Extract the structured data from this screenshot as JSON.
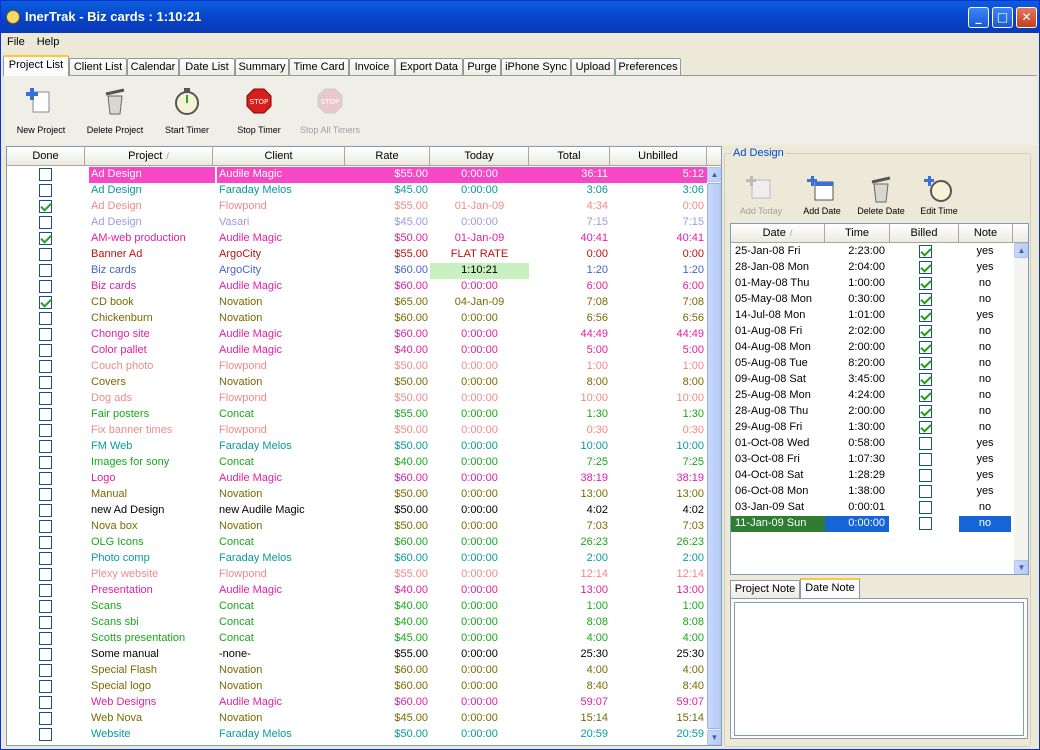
{
  "window": {
    "title": "InerTrak - Biz cards : 1:10:21",
    "min_label": "_",
    "max_label": "□",
    "close_label": "✕"
  },
  "menu": [
    {
      "label": "File"
    },
    {
      "label": "Help"
    }
  ],
  "tabs": [
    {
      "label": "Project List",
      "selected": true
    },
    {
      "label": "Client List"
    },
    {
      "label": "Calendar"
    },
    {
      "label": "Date List"
    },
    {
      "label": "Summary"
    },
    {
      "label": "Time Card"
    },
    {
      "label": "Invoice"
    },
    {
      "label": "Export Data"
    },
    {
      "label": "Purge"
    },
    {
      "label": "iPhone Sync"
    },
    {
      "label": "Upload"
    },
    {
      "label": "Preferences"
    }
  ],
  "toolbar": [
    {
      "label": "New Project",
      "icon": "new-project-icon",
      "enabled": true
    },
    {
      "label": "Delete Project",
      "icon": "trash-icon",
      "enabled": true
    },
    {
      "label": "Start Timer",
      "icon": "stopwatch-icon",
      "enabled": true
    },
    {
      "label": "Stop Timer",
      "icon": "stop-sign-icon",
      "enabled": true
    },
    {
      "label": "Stop All Timers",
      "icon": "stop-all-icon",
      "enabled": false
    }
  ],
  "project_grid": {
    "columns": [
      "Done",
      "Project",
      "Client",
      "Rate",
      "Today",
      "Total",
      "Unbilled"
    ],
    "sort_indicator": "/",
    "rows": [
      {
        "done": false,
        "project": "Ad Design",
        "client": "Audile Magic",
        "rate": "$55.00",
        "today": "0:00:00",
        "total": "36:11",
        "unbilled": "5:12",
        "color": "#e020a0",
        "selected": true
      },
      {
        "done": false,
        "project": "Ad Design",
        "client": "Faraday Melos",
        "rate": "$45.00",
        "today": "0:00:00",
        "total": "3:06",
        "unbilled": "3:06",
        "color": "#0a9a9a"
      },
      {
        "done": true,
        "project": "Ad Design",
        "client": "Flowpond",
        "rate": "$55.00",
        "today": "01-Jan-09",
        "total": "4:34",
        "unbilled": "0:00",
        "color": "#f08a8a"
      },
      {
        "done": false,
        "project": "Ad Design",
        "client": "Vasari",
        "rate": "$45.00",
        "today": "0:00:00",
        "total": "7:15",
        "unbilled": "7:15",
        "color": "#9a9ae0"
      },
      {
        "done": true,
        "project": "AM-web production",
        "client": "Audile Magic",
        "rate": "$50.00",
        "today": "01-Jan-09",
        "total": "40:41",
        "unbilled": "40:41",
        "color": "#e020a0"
      },
      {
        "done": false,
        "project": "Banner Ad",
        "client": "ArgoCity",
        "rate": "$55.00",
        "today": "FLAT RATE",
        "total": "0:00",
        "unbilled": "0:00",
        "color": "#c01010"
      },
      {
        "done": false,
        "project": "Biz cards",
        "client": "ArgoCity",
        "rate": "$60.00",
        "today": "1:10:21",
        "total": "1:20",
        "unbilled": "1:20",
        "color": "#4a60d0",
        "today_highlight": true
      },
      {
        "done": false,
        "project": "Biz cards",
        "client": "Audile Magic",
        "rate": "$60.00",
        "today": "0:00:00",
        "total": "6:00",
        "unbilled": "6:00",
        "color": "#e020a0"
      },
      {
        "done": true,
        "project": "CD book",
        "client": "Novation",
        "rate": "$65.00",
        "today": "04-Jan-09",
        "total": "7:08",
        "unbilled": "7:08",
        "color": "#7a6a00"
      },
      {
        "done": false,
        "project": "Chickenburn",
        "client": "Novation",
        "rate": "$60.00",
        "today": "0:00:00",
        "total": "6:56",
        "unbilled": "6:56",
        "color": "#7a6a00"
      },
      {
        "done": false,
        "project": "Chongo site",
        "client": "Audile Magic",
        "rate": "$60.00",
        "today": "0:00:00",
        "total": "44:49",
        "unbilled": "44:49",
        "color": "#e020a0"
      },
      {
        "done": false,
        "project": "Color pallet",
        "client": "Audile Magic",
        "rate": "$40.00",
        "today": "0:00:00",
        "total": "5:00",
        "unbilled": "5:00",
        "color": "#e020a0"
      },
      {
        "done": false,
        "project": "Couch photo",
        "client": "Flowpond",
        "rate": "$50.00",
        "today": "0:00:00",
        "total": "1:00",
        "unbilled": "1:00",
        "color": "#f08a8a"
      },
      {
        "done": false,
        "project": "Covers",
        "client": "Novation",
        "rate": "$50.00",
        "today": "0:00:00",
        "total": "8:00",
        "unbilled": "8:00",
        "color": "#7a6a00"
      },
      {
        "done": false,
        "project": "Dog ads",
        "client": "Flowpond",
        "rate": "$50.00",
        "today": "0:00:00",
        "total": "10:00",
        "unbilled": "10:00",
        "color": "#f08a8a"
      },
      {
        "done": false,
        "project": "Fair posters",
        "client": "Concat",
        "rate": "$55.00",
        "today": "0:00:00",
        "total": "1:30",
        "unbilled": "1:30",
        "color": "#18a818"
      },
      {
        "done": false,
        "project": "Fix banner times",
        "client": "Flowpond",
        "rate": "$50.00",
        "today": "0:00:00",
        "total": "0:30",
        "unbilled": "0:30",
        "color": "#f08a8a"
      },
      {
        "done": false,
        "project": "FM Web",
        "client": "Faraday Melos",
        "rate": "$50.00",
        "today": "0:00:00",
        "total": "10:00",
        "unbilled": "10:00",
        "color": "#0a9a9a"
      },
      {
        "done": false,
        "project": "Images for sony",
        "client": "Concat",
        "rate": "$40.00",
        "today": "0:00:00",
        "total": "7:25",
        "unbilled": "7:25",
        "color": "#18a818"
      },
      {
        "done": false,
        "project": "Logo",
        "client": "Audile Magic",
        "rate": "$60.00",
        "today": "0:00:00",
        "total": "38:19",
        "unbilled": "38:19",
        "color": "#e020a0"
      },
      {
        "done": false,
        "project": "Manual",
        "client": "Novation",
        "rate": "$50.00",
        "today": "0:00:00",
        "total": "13:00",
        "unbilled": "13:00",
        "color": "#7a6a00"
      },
      {
        "done": false,
        "project": "new Ad Design",
        "client": "new Audile Magic",
        "rate": "$50.00",
        "today": "0:00:00",
        "total": "4:02",
        "unbilled": "4:02",
        "color": "#000000"
      },
      {
        "done": false,
        "project": "Nova box",
        "client": "Novation",
        "rate": "$50.00",
        "today": "0:00:00",
        "total": "7:03",
        "unbilled": "7:03",
        "color": "#7a6a00"
      },
      {
        "done": false,
        "project": "OLG Icons",
        "client": "Concat",
        "rate": "$60.00",
        "today": "0:00:00",
        "total": "26:23",
        "unbilled": "26:23",
        "color": "#18a818"
      },
      {
        "done": false,
        "project": "Photo comp",
        "client": "Faraday Melos",
        "rate": "$60.00",
        "today": "0:00:00",
        "total": "2:00",
        "unbilled": "2:00",
        "color": "#0a9a9a"
      },
      {
        "done": false,
        "project": "Plexy website",
        "client": "Flowpond",
        "rate": "$55.00",
        "today": "0:00:00",
        "total": "12:14",
        "unbilled": "12:14",
        "color": "#f08a8a"
      },
      {
        "done": false,
        "project": "Presentation",
        "client": "Audile Magic",
        "rate": "$40.00",
        "today": "0:00:00",
        "total": "13:00",
        "unbilled": "13:00",
        "color": "#e020a0"
      },
      {
        "done": false,
        "project": "Scans",
        "client": "Concat",
        "rate": "$40.00",
        "today": "0:00:00",
        "total": "1:00",
        "unbilled": "1:00",
        "color": "#18a818"
      },
      {
        "done": false,
        "project": "Scans sbi",
        "client": "Concat",
        "rate": "$40.00",
        "today": "0:00:00",
        "total": "8:08",
        "unbilled": "8:08",
        "color": "#18a818"
      },
      {
        "done": false,
        "project": "Scotts presentation",
        "client": "Concat",
        "rate": "$45.00",
        "today": "0:00:00",
        "total": "4:00",
        "unbilled": "4:00",
        "color": "#18a818"
      },
      {
        "done": false,
        "project": "Some manual",
        "client": "-none-",
        "rate": "$55.00",
        "today": "0:00:00",
        "total": "25:30",
        "unbilled": "25:30",
        "color": "#000000"
      },
      {
        "done": false,
        "project": "Special Flash",
        "client": "Novation",
        "rate": "$60.00",
        "today": "0:00:00",
        "total": "4:00",
        "unbilled": "4:00",
        "color": "#7a6a00"
      },
      {
        "done": false,
        "project": "Special logo",
        "client": "Novation",
        "rate": "$60.00",
        "today": "0:00:00",
        "total": "8:40",
        "unbilled": "8:40",
        "color": "#7a6a00"
      },
      {
        "done": false,
        "project": "Web Designs",
        "client": "Audile Magic",
        "rate": "$60.00",
        "today": "0:00:00",
        "total": "59:07",
        "unbilled": "59:07",
        "color": "#e020a0"
      },
      {
        "done": false,
        "project": "Web Nova",
        "client": "Novation",
        "rate": "$45.00",
        "today": "0:00:00",
        "total": "15:14",
        "unbilled": "15:14",
        "color": "#7a6a00"
      },
      {
        "done": false,
        "project": "Website",
        "client": "Faraday Melos",
        "rate": "$50.00",
        "today": "0:00:00",
        "total": "20:59",
        "unbilled": "20:59",
        "color": "#0a9a9a"
      }
    ]
  },
  "detail": {
    "title": "Ad Design",
    "toolbar": [
      {
        "label": "Add Today",
        "icon": "add-today-icon",
        "enabled": false
      },
      {
        "label": "Add Date",
        "icon": "calendar-add-icon",
        "enabled": true
      },
      {
        "label": "Delete Date",
        "icon": "trash-icon",
        "enabled": true
      },
      {
        "label": "Edit Time",
        "icon": "edit-time-icon",
        "enabled": true
      }
    ],
    "columns": [
      "Date",
      "Time",
      "Billed",
      "Note"
    ],
    "sort_indicator": "/",
    "rows": [
      {
        "date": "25-Jan-08 Fri",
        "time": "2:23:00",
        "billed": true,
        "note": "yes"
      },
      {
        "date": "28-Jan-08 Mon",
        "time": "2:04:00",
        "billed": true,
        "note": "yes"
      },
      {
        "date": "01-May-08 Thu",
        "time": "1:00:00",
        "billed": true,
        "note": "no"
      },
      {
        "date": "05-May-08 Mon",
        "time": "0:30:00",
        "billed": true,
        "note": "no"
      },
      {
        "date": "14-Jul-08 Mon",
        "time": "1:01:00",
        "billed": true,
        "note": "yes"
      },
      {
        "date": "01-Aug-08 Fri",
        "time": "2:02:00",
        "billed": true,
        "note": "no"
      },
      {
        "date": "04-Aug-08 Mon",
        "time": "2:00:00",
        "billed": true,
        "note": "no"
      },
      {
        "date": "05-Aug-08 Tue",
        "time": "8:20:00",
        "billed": true,
        "note": "no"
      },
      {
        "date": "09-Aug-08 Sat",
        "time": "3:45:00",
        "billed": true,
        "note": "no"
      },
      {
        "date": "25-Aug-08 Mon",
        "time": "4:24:00",
        "billed": true,
        "note": "no"
      },
      {
        "date": "28-Aug-08 Thu",
        "time": "2:00:00",
        "billed": true,
        "note": "no"
      },
      {
        "date": "29-Aug-08 Fri",
        "time": "1:30:00",
        "billed": true,
        "note": "no"
      },
      {
        "date": "01-Oct-08 Wed",
        "time": "0:58:00",
        "billed": false,
        "note": "yes"
      },
      {
        "date": "03-Oct-08 Fri",
        "time": "1:07:30",
        "billed": false,
        "note": "yes"
      },
      {
        "date": "04-Oct-08 Sat",
        "time": "1:28:29",
        "billed": false,
        "note": "yes"
      },
      {
        "date": "06-Oct-08 Mon",
        "time": "1:38:00",
        "billed": false,
        "note": "yes"
      },
      {
        "date": "03-Jan-09 Sat",
        "time": "0:00:01",
        "billed": false,
        "note": "no"
      },
      {
        "date": "11-Jan-09 Sun",
        "time": "0:00:00",
        "billed": false,
        "note": "no",
        "selected": true
      }
    ],
    "note_tabs": [
      {
        "label": "Project Note"
      },
      {
        "label": "Date Note",
        "selected": true
      }
    ],
    "note_text": ""
  }
}
